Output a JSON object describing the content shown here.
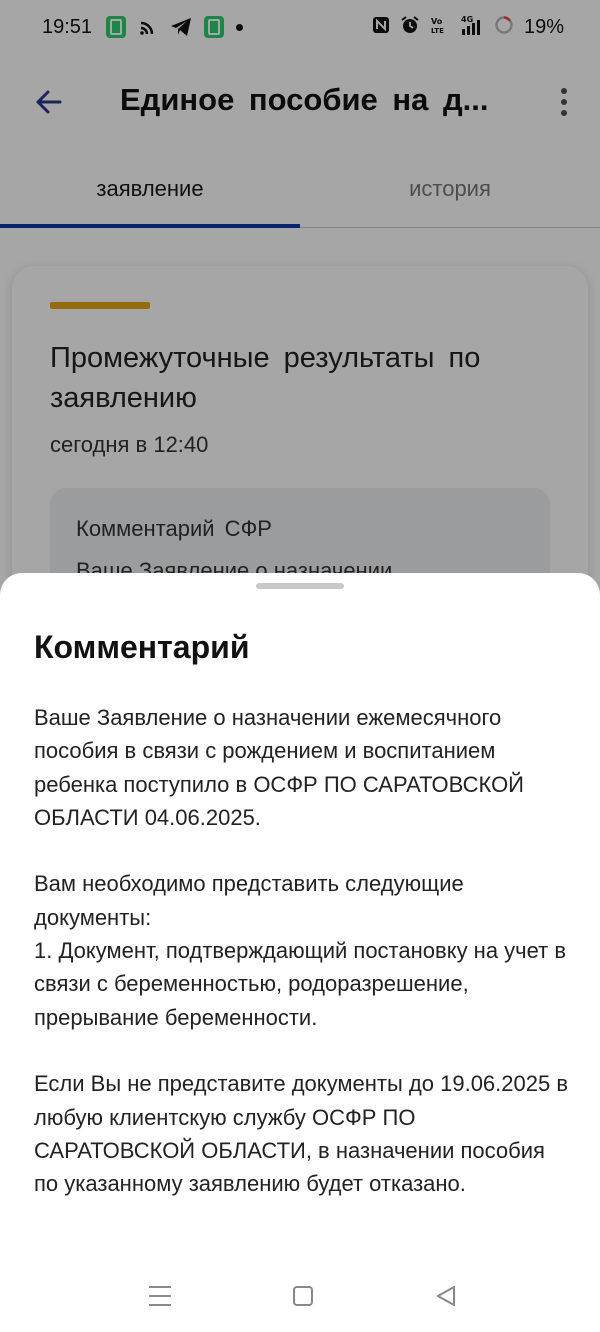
{
  "status_bar": {
    "time": "19:51",
    "battery": "19%",
    "icons": [
      "app-notification-icon",
      "cast-icon",
      "telegram-icon",
      "app-notification-icon",
      "dot-icon",
      "nfc-icon",
      "alarm-icon",
      "volte-icon",
      "signal-4g-icon",
      "battery-icon"
    ]
  },
  "app_bar": {
    "title": "Единое пособие на д..."
  },
  "tabs": [
    {
      "label": "заявление"
    },
    {
      "label": "история"
    }
  ],
  "card": {
    "title": "Промежуточные результаты по заявлению",
    "date": "сегодня в 12:40",
    "comment_label": "Комментарий СФР",
    "comment_preview": "Ваше Заявление о назначении"
  },
  "sheet": {
    "title": "Комментарий",
    "paragraphs": [
      "Ваше Заявление о назначении ежемесячного пособия в связи с рождением и воспитанием ребенка поступило в ОСФР ПО САРАТОВСКОЙ ОБЛАСТИ 04.06.2025.",
      "Вам необходимо представить следующие документы:\n1. Документ, подтверждающий постановку на учет в связи с беременностью, родоразрешение, прерывание беременности.",
      "Если Вы не представите документы до 19.06.2025 в любую клиентскую службу ОСФР ПО САРАТОВСКОЙ ОБЛАСТИ, в назначении пособия по указанному заявлению будет отказано."
    ]
  },
  "colors": {
    "tab_indicator": "#0d3aa8",
    "card_accent": "#e3a514",
    "scrim": "rgba(0,0,0,0.35)"
  }
}
